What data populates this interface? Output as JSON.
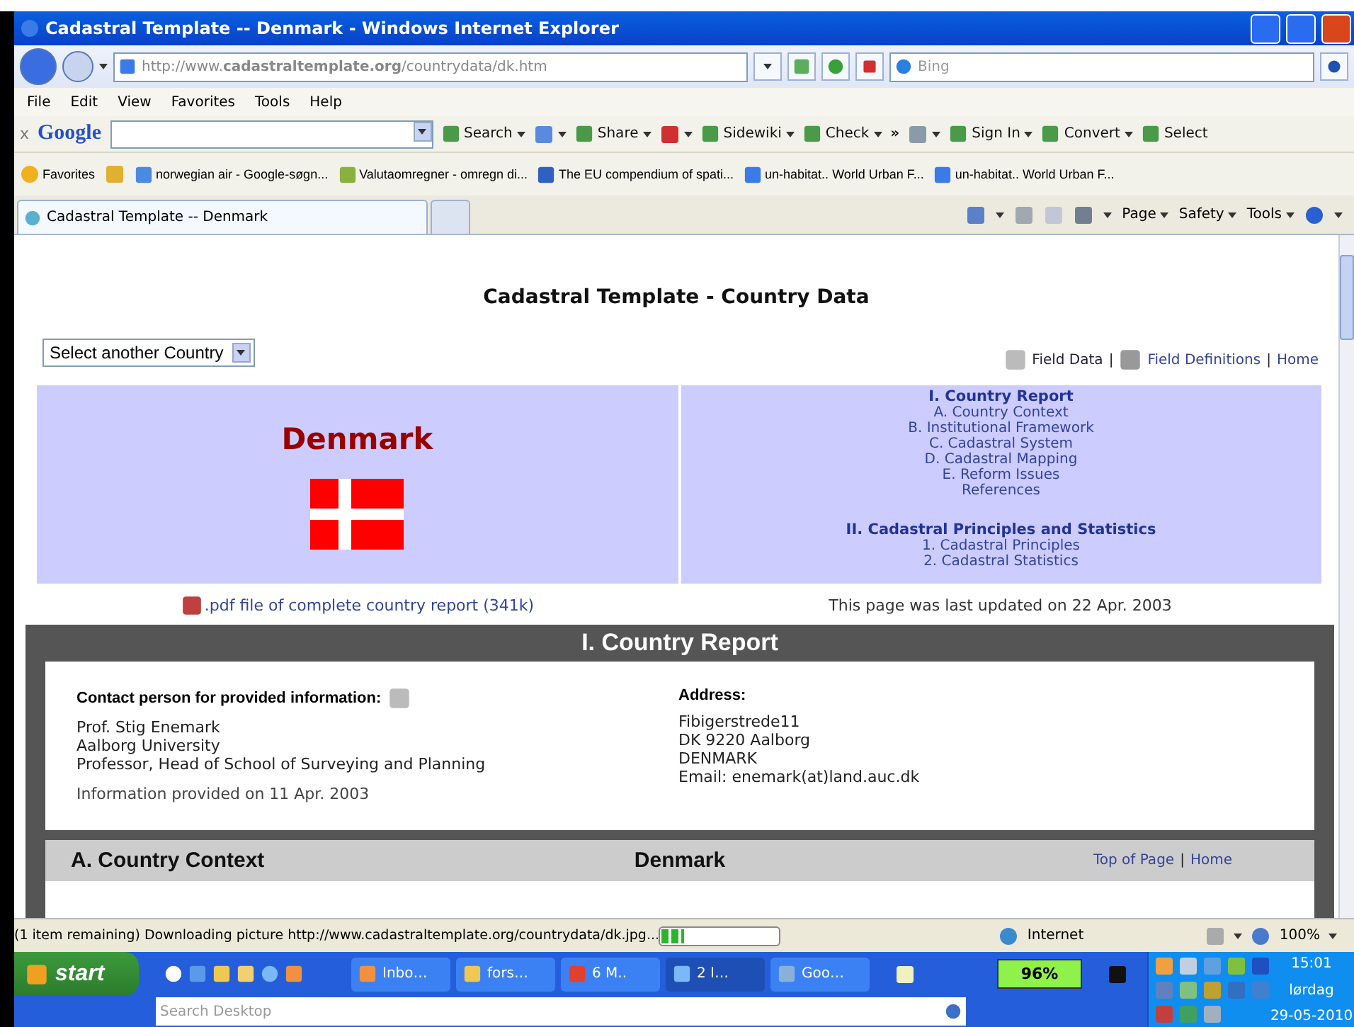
{
  "window": {
    "title": "Cadastral Template -- Denmark - Windows Internet Explorer"
  },
  "address_bar": {
    "url": "http://www.**cadastraltemplate.org**/countrydata/dk.htm",
    "search_placeholder": "Bing"
  },
  "menu": [
    "File",
    "Edit",
    "View",
    "Favorites",
    "Tools",
    "Help"
  ],
  "google_toolbar": {
    "close": "x",
    "logo": "Google",
    "buttons": [
      {
        "kind": "button",
        "label": "Search",
        "dropdown": true
      },
      {
        "kind": "icon",
        "dropdown": true
      },
      {
        "kind": "button",
        "label": "Share",
        "dropdown": true
      },
      {
        "kind": "icon",
        "dropdown": true
      },
      {
        "kind": "button",
        "label": "Sidewiki",
        "dropdown": true
      },
      {
        "kind": "button",
        "label": "Check",
        "dropdown": true
      },
      {
        "kind": "chevron",
        "label": "»",
        "dropdown": false
      },
      {
        "kind": "icon",
        "dropdown": true
      },
      {
        "kind": "button",
        "label": "Sign In",
        "dropdown": true
      },
      {
        "kind": "button",
        "label": "Convert",
        "dropdown": true
      },
      {
        "kind": "button",
        "label": "Select",
        "dropdown": false
      }
    ]
  },
  "favorites": {
    "label": "Favorites",
    "links": [
      "norwegian air - Google-søgn...",
      "Valutaomregner - omregn di...",
      "The EU compendium of spati...",
      "un-habitat.. World Urban F...",
      "un-habitat.. World Urban F..."
    ]
  },
  "tabs": [
    {
      "label": "Cadastral Template -- Denmark",
      "selected": true
    }
  ],
  "command_bar": [
    "Page",
    "Safety",
    "Tools"
  ],
  "page": {
    "title": "Cadastral Template - Country Data",
    "country_select": "Select another Country",
    "top_links": [
      "Field Data",
      "Field Definitions",
      "Home"
    ],
    "separator": "|",
    "country": "Denmark",
    "toc": [
      {
        "heading": "I. Country Report",
        "items": [
          "A. Country Context",
          "B. Institutional Framework",
          "C. Cadastral System",
          "D. Cadastral Mapping",
          "E. Reform Issues",
          "References"
        ]
      },
      {
        "heading": "II. Cadastral Principles and Statistics",
        "items": [
          "1. Cadastral Principles",
          "2. Cadastral Statistics"
        ]
      }
    ],
    "pdf_link": ".pdf file of complete country report (341k)",
    "updated": "This page was last updated on 22 Apr. 2003",
    "report": {
      "title": "I. Country Report",
      "contact_label": "Contact person for provided information:",
      "contact_lines": [
        "Prof. Stig Enemark",
        "Aalborg University",
        "Professor, Head of School of Surveying and Planning"
      ],
      "info_provided": "Information provided on 11 Apr. 2003",
      "address_label": "Address:",
      "address_lines": [
        "Fibigerstrede11",
        "DK 9220 Aalborg",
        "DENMARK",
        "Email: enemark(at)land.auc.dk"
      ]
    },
    "section": {
      "title": "A. Country Context",
      "country": "Denmark",
      "links": [
        "Top of Page",
        "Home"
      ]
    }
  },
  "status_bar": {
    "text": "(1 item remaining) Downloading picture http://www.cadastraltemplate.org/countrydata/dk.jpg...",
    "level": 0.2,
    "zone": "Internet",
    "zoom": "100%"
  },
  "taskbar": {
    "start": "start",
    "tasks": [
      {
        "label": "Inbo…",
        "selected": false
      },
      {
        "label": "fors…",
        "selected": false
      },
      {
        "label": "6 M..",
        "selected": false
      },
      {
        "label": "2 I…",
        "selected": true
      },
      {
        "label": "Goo…",
        "selected": false
      }
    ],
    "search_placeholder": "Search Desktop",
    "battery": "96%",
    "time": "15:01",
    "day": "lørdag",
    "date": "29-05-2010"
  }
}
